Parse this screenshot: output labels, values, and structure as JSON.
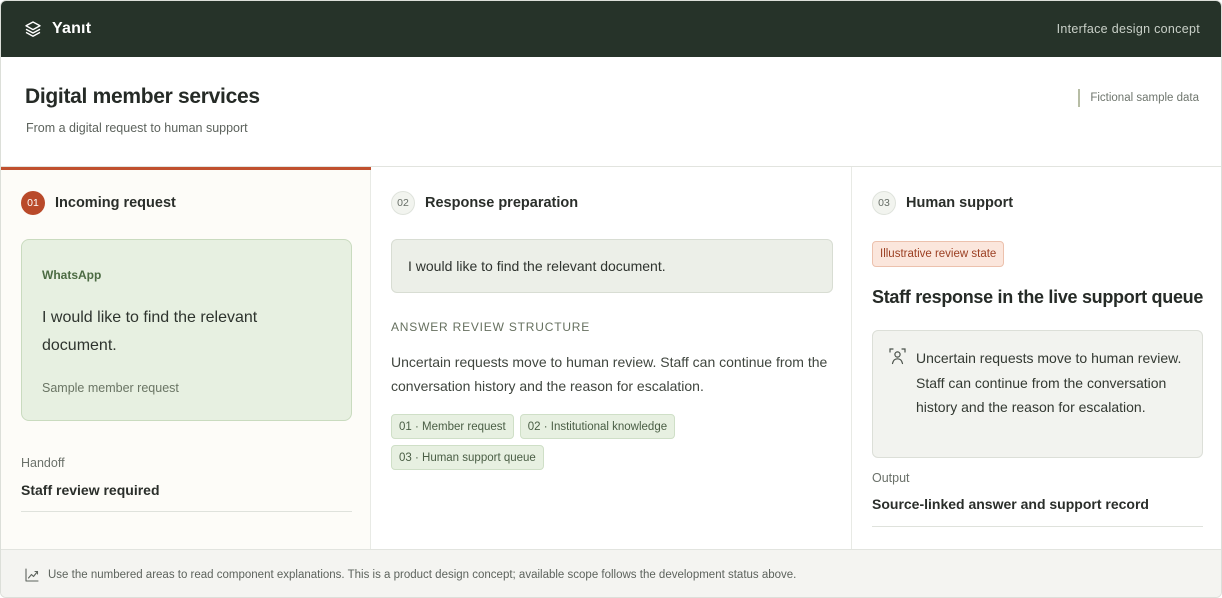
{
  "app": {
    "name": "Yanıt",
    "tagline": "Interface design concept",
    "brand_icon": "layers-icon"
  },
  "header": {
    "title": "Digital member services",
    "subtitle": "From a digital request to human support",
    "sample_note": "Fictional sample data"
  },
  "columns": {
    "incoming": {
      "number": "01",
      "label": "Incoming request",
      "channel": "WhatsApp",
      "message": "I would like to find the relevant document.",
      "caption": "Sample member request",
      "handoff_label": "Handoff",
      "handoff_value": "Staff review required"
    },
    "preparation": {
      "number": "02",
      "label": "Response preparation",
      "quote": "I would like to find the relevant document.",
      "section_caption": "ANSWER REVIEW STRUCTURE",
      "review_text": "Uncertain requests move to human review. Staff can continue from the conversation history and the reason for escalation.",
      "chips": [
        "01 · Member request",
        "02 · Institutional knowledge",
        "03 · Human support queue"
      ]
    },
    "support": {
      "number": "03",
      "label": "Human support",
      "state_badge": "Illustrative review state",
      "queue_title": "Staff response in the live support queue",
      "staff_icon": "person-icon",
      "staff_text": "Uncertain requests move to human review. Staff can continue from the conversation history and the reason for escalation.",
      "output_label": "Output",
      "output_value": "Source-linked answer and support record"
    }
  },
  "footer": {
    "icon": "chart-line-icon",
    "text": "Use the numbered areas to read component explanations. This is a product design concept; available scope follows the development status above."
  },
  "colors": {
    "topbar": "#263329",
    "accent": "#c0502f",
    "step_active": "#b94a2a",
    "message_card": "#e7f0e1",
    "badge": "#fbe6dc"
  }
}
